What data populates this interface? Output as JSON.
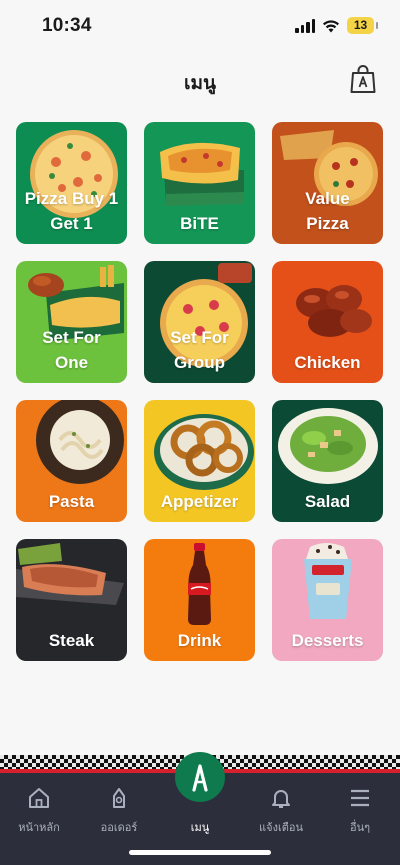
{
  "status": {
    "time": "10:34",
    "battery": "13"
  },
  "header": {
    "title": "เมนู"
  },
  "tiles": [
    {
      "label": "Pizza Buy 1\nGet 1",
      "bg": "#0d8d51"
    },
    {
      "label": "BiTE",
      "bg": "#149657"
    },
    {
      "label": "Value\nPizza",
      "bg": "#c2511c"
    },
    {
      "label": "Set For\nOne",
      "bg": "#6cc13d"
    },
    {
      "label": "Set For\nGroup",
      "bg": "#0c4a33"
    },
    {
      "label": "Chicken",
      "bg": "#e45017"
    },
    {
      "label": "Pasta",
      "bg": "#ee7718"
    },
    {
      "label": "Appetizer",
      "bg": "#f4c624"
    },
    {
      "label": "Salad",
      "bg": "#0b4a34"
    },
    {
      "label": "Steak",
      "bg": "#26272b"
    },
    {
      "label": "Drink",
      "bg": "#f47c0f"
    },
    {
      "label": "Desserts",
      "bg": "#f1a8c0"
    }
  ],
  "nav": {
    "home": "หน้าหลัก",
    "order": "ออเดอร์",
    "menu": "เมนู",
    "notify": "แจ้งเตือน",
    "more": "อื่นๆ"
  }
}
